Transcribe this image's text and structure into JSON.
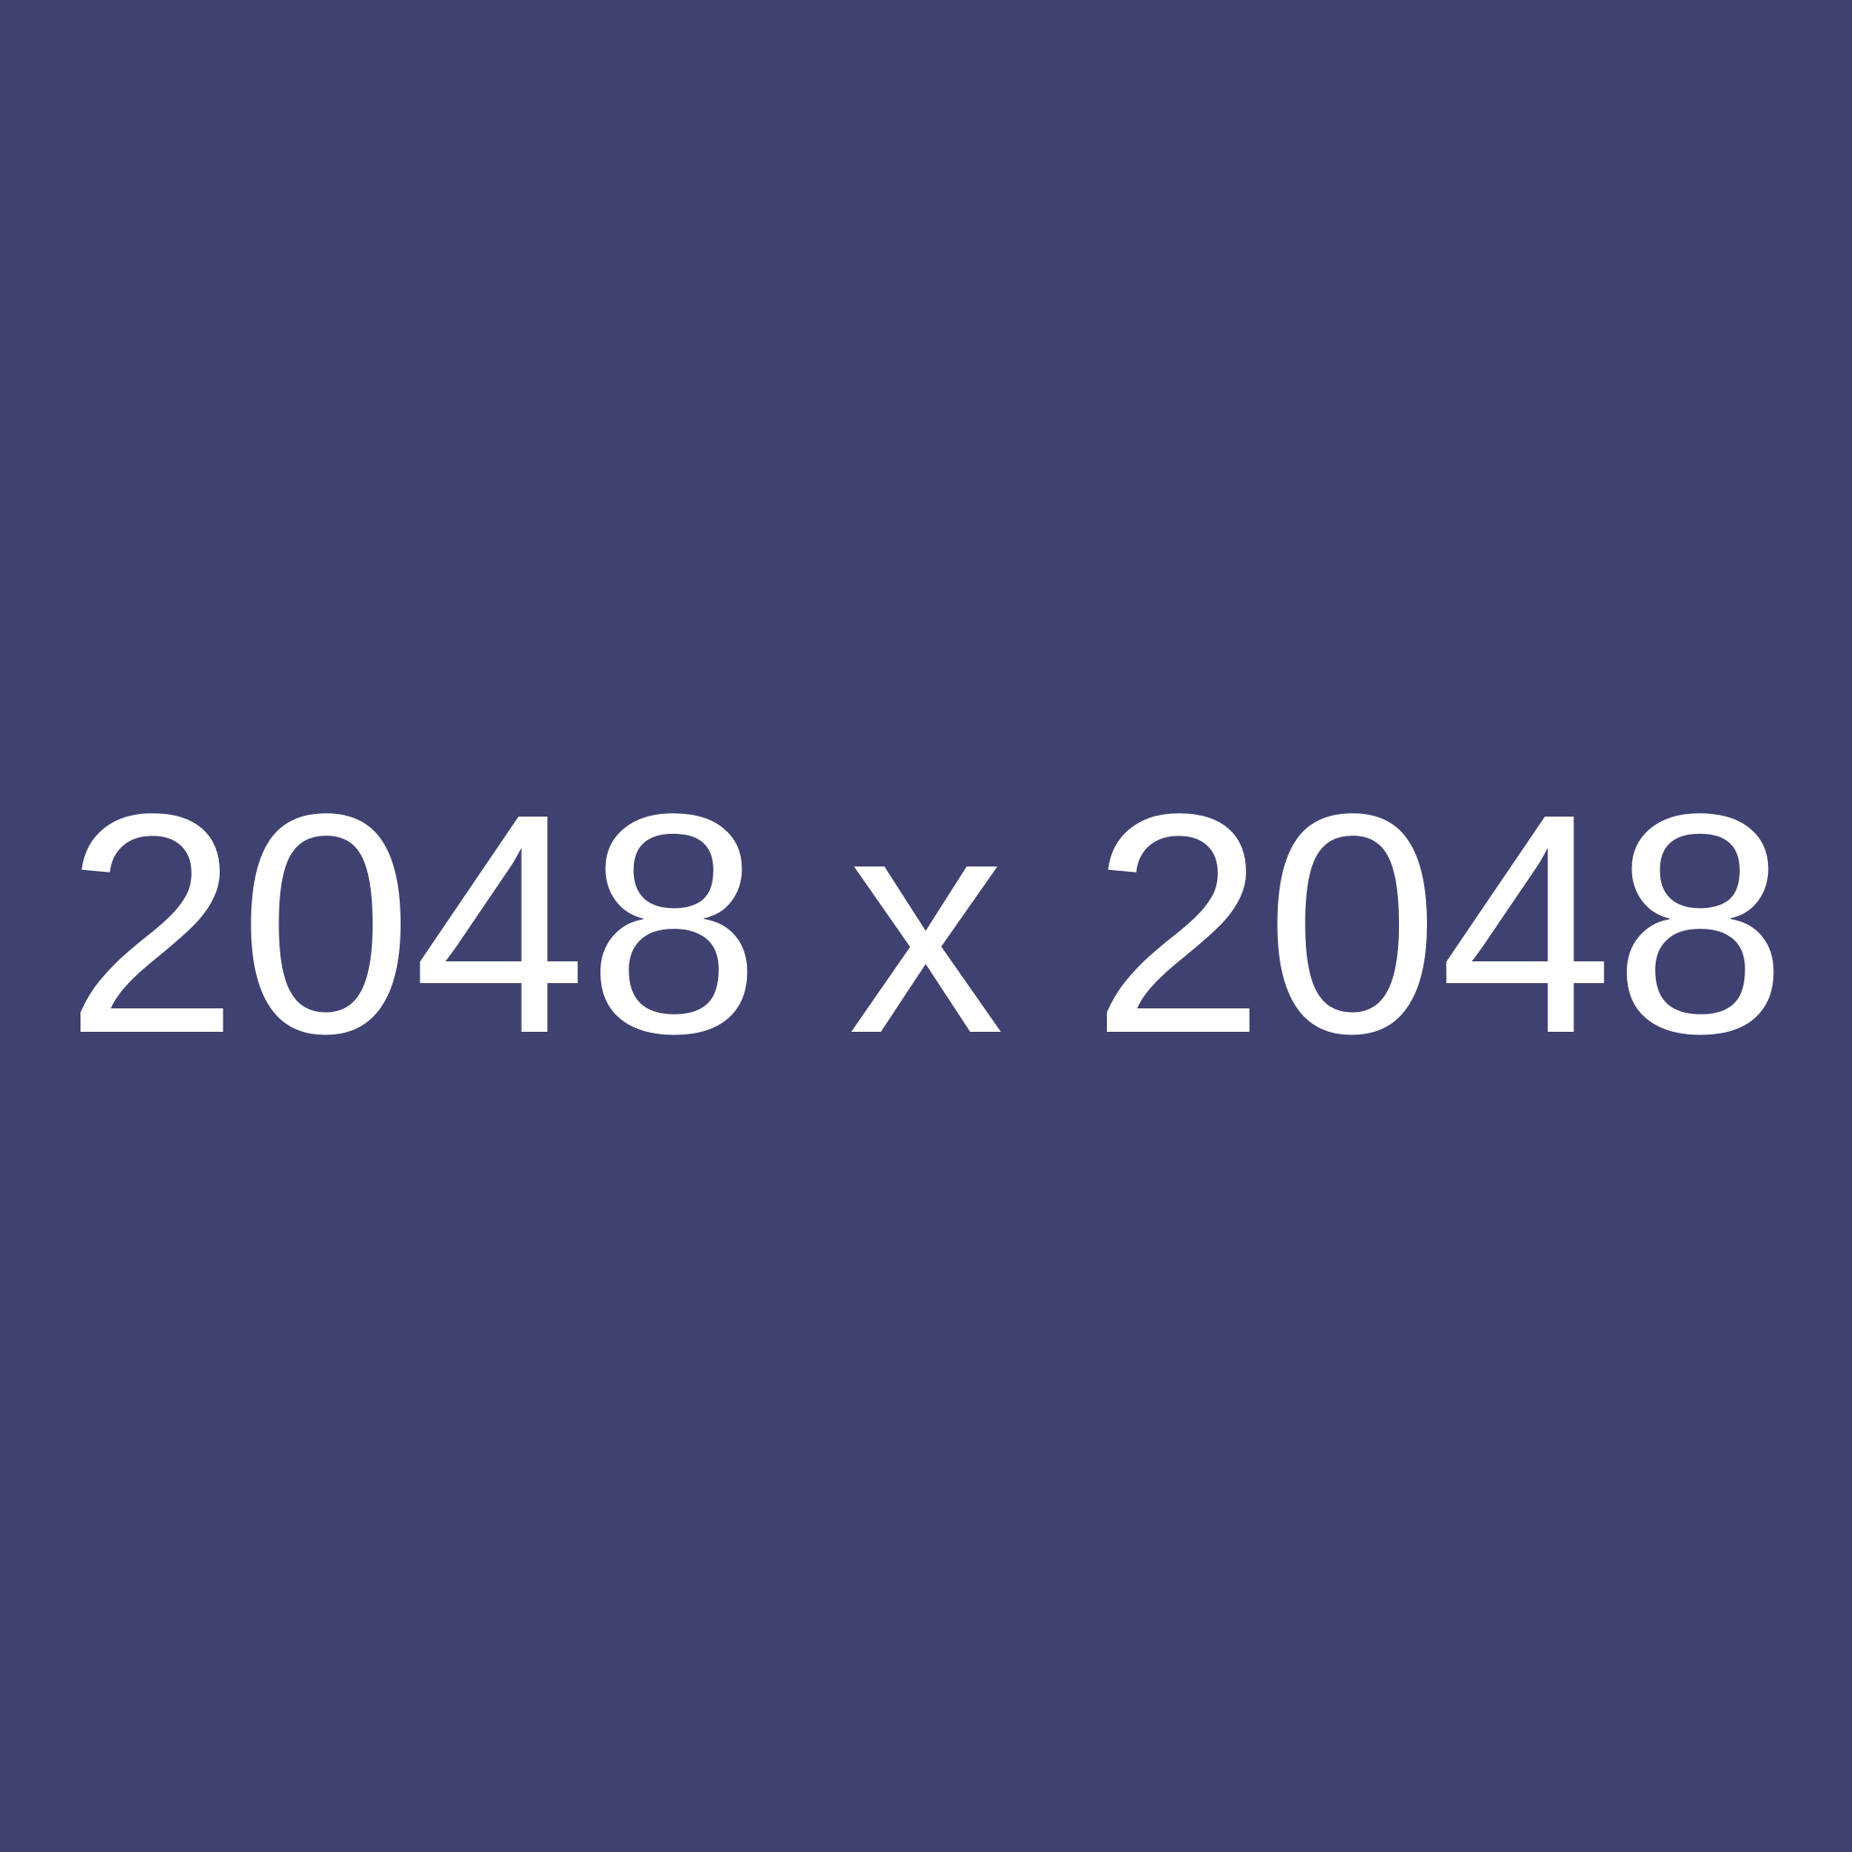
{
  "background_color": "#3f4170",
  "text_color": "#ffffff",
  "label": "2048 x 2048"
}
